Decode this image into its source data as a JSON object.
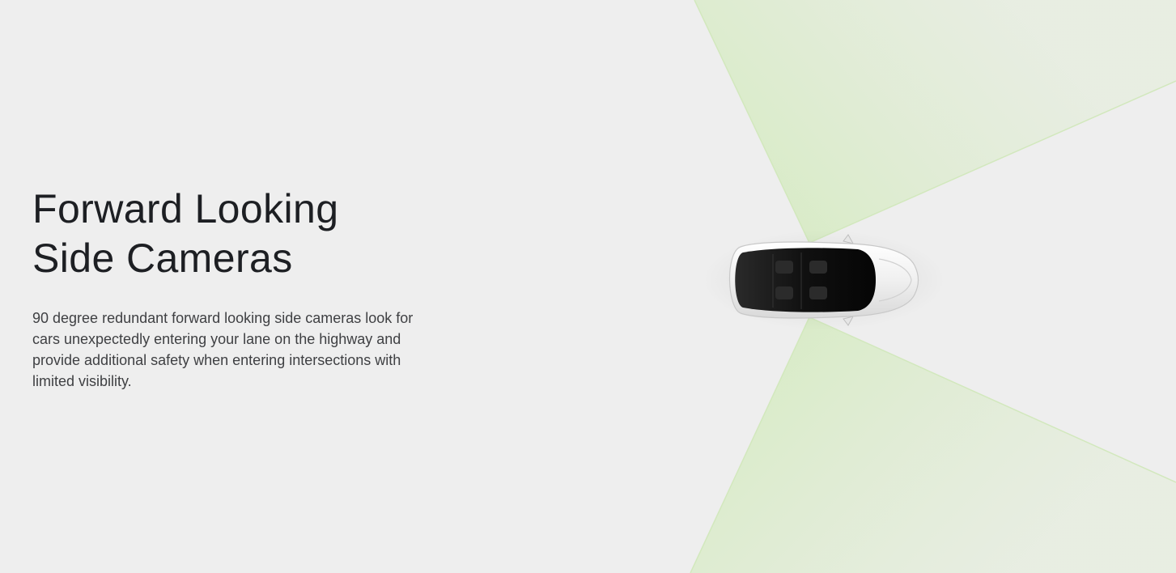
{
  "section": {
    "title_line1": "Forward Looking",
    "title_line2": "Side Cameras",
    "description": "90 degree redundant forward looking side cameras look for cars unexpectedly entering your lane on the highway and provide additional safety when entering intersections with limited visibility."
  },
  "colors": {
    "background": "#eeeeee",
    "camera_cone": "#cfe8b8",
    "car_body": "#f4f4f4",
    "glass": "#141414"
  }
}
